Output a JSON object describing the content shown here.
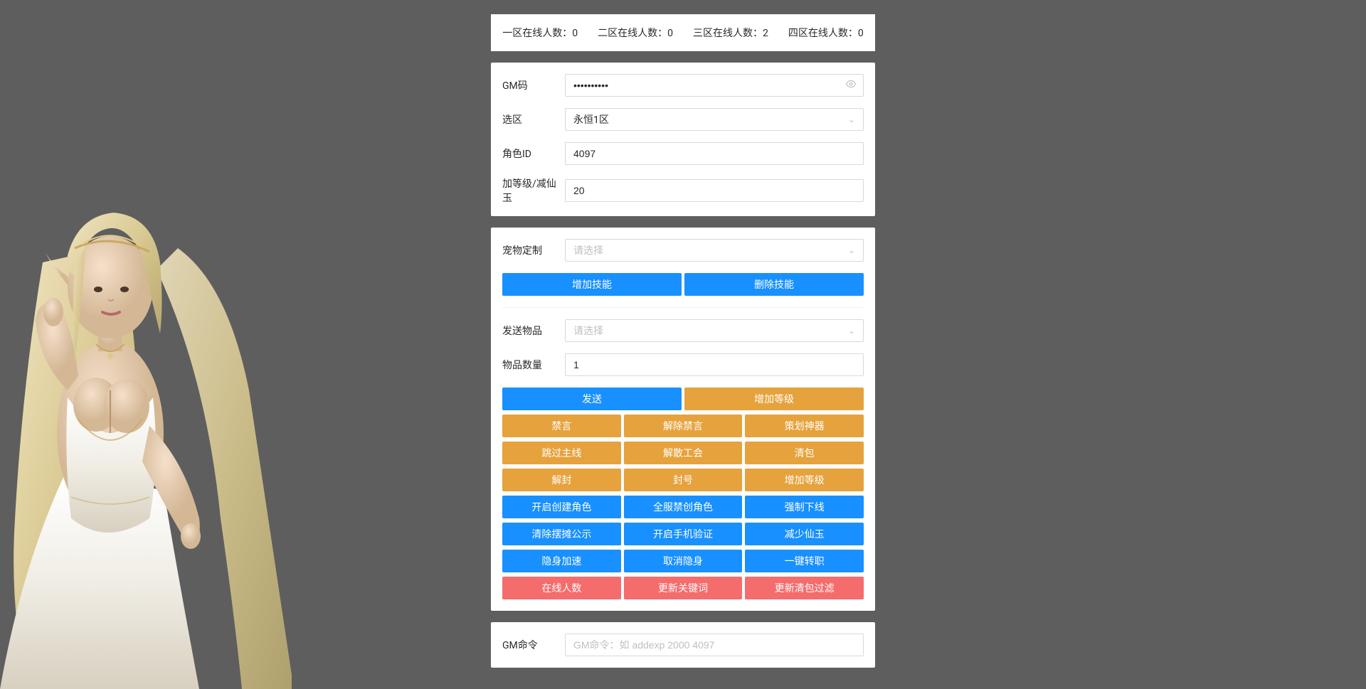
{
  "status_bar": "一区在线人数：0　　二区在线人数：0　　三区在线人数：2　　四区在线人数：0",
  "form1": {
    "gm_code_label": "GM码",
    "gm_code_value": "••••••••••",
    "zone_label": "选区",
    "zone_value": "永恒1区",
    "role_id_label": "角色ID",
    "role_id_value": "4097",
    "level_label": "加等级/减仙玉",
    "level_value": "20"
  },
  "form2": {
    "pet_label": "宠物定制",
    "pet_placeholder": "请选择",
    "add_skill": "增加技能",
    "remove_skill": "删除技能"
  },
  "form3": {
    "send_item_label": "发送物品",
    "send_item_placeholder": "请选择",
    "item_qty_label": "物品数量",
    "item_qty_value": "1"
  },
  "buttons": {
    "row1": [
      "发送",
      "增加等级"
    ],
    "row2": [
      "禁言",
      "解除禁言",
      "策划神器"
    ],
    "row3": [
      "跳过主线",
      "解散工会",
      "清包"
    ],
    "row4": [
      "解封",
      "封号",
      "增加等级"
    ],
    "row5": [
      "开启创建角色",
      "全服禁创角色",
      "强制下线"
    ],
    "row6": [
      "清除摆摊公示",
      "开启手机验证",
      "减少仙玉"
    ],
    "row7": [
      "隐身加速",
      "取消隐身",
      "一键转职"
    ],
    "row8": [
      "在线人数",
      "更新关键词",
      "更新清包过滤"
    ]
  },
  "form4": {
    "gm_cmd_label": "GM命令",
    "gm_cmd_placeholder": "GM命令：如 addexp 2000 4097"
  }
}
